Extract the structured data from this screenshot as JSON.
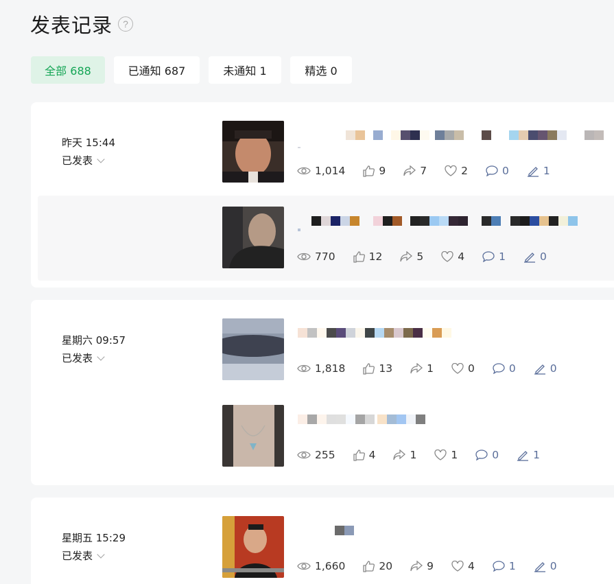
{
  "header": {
    "title": "发表记录",
    "help": "?"
  },
  "tabs": [
    {
      "label": "全部 688",
      "active": true
    },
    {
      "label": "已通知 687",
      "active": false
    },
    {
      "label": "未通知 1",
      "active": false
    },
    {
      "label": "精选 0",
      "active": false
    }
  ],
  "groups": [
    {
      "time": "昨天 15:44",
      "status": "已发表",
      "articles": [
        {
          "views": "1,014",
          "likes": "9",
          "shares": "7",
          "favs": "2",
          "comments": "0",
          "edits": "1"
        },
        {
          "views": "770",
          "likes": "12",
          "shares": "5",
          "favs": "4",
          "comments": "1",
          "edits": "0"
        }
      ]
    },
    {
      "time": "星期六 09:57",
      "status": "已发表",
      "articles": [
        {
          "views": "1,818",
          "likes": "13",
          "shares": "1",
          "favs": "0",
          "comments": "0",
          "edits": "0"
        },
        {
          "views": "255",
          "likes": "4",
          "shares": "1",
          "favs": "1",
          "comments": "0",
          "edits": "1"
        }
      ]
    },
    {
      "time": "星期五 15:29",
      "status": "已发表",
      "articles": [
        {
          "views": "1,660",
          "likes": "20",
          "shares": "9",
          "favs": "4",
          "comments": "1",
          "edits": "0"
        }
      ]
    }
  ],
  "colors": {
    "accent": "#14a555",
    "accent_bg": "#dff3e7",
    "link_blue": "#5a6e9a"
  },
  "icons": [
    "help-icon",
    "chevron-down-icon",
    "eye-icon",
    "thumbs-up-icon",
    "share-icon",
    "heart-icon",
    "comment-icon",
    "pen-icon"
  ]
}
